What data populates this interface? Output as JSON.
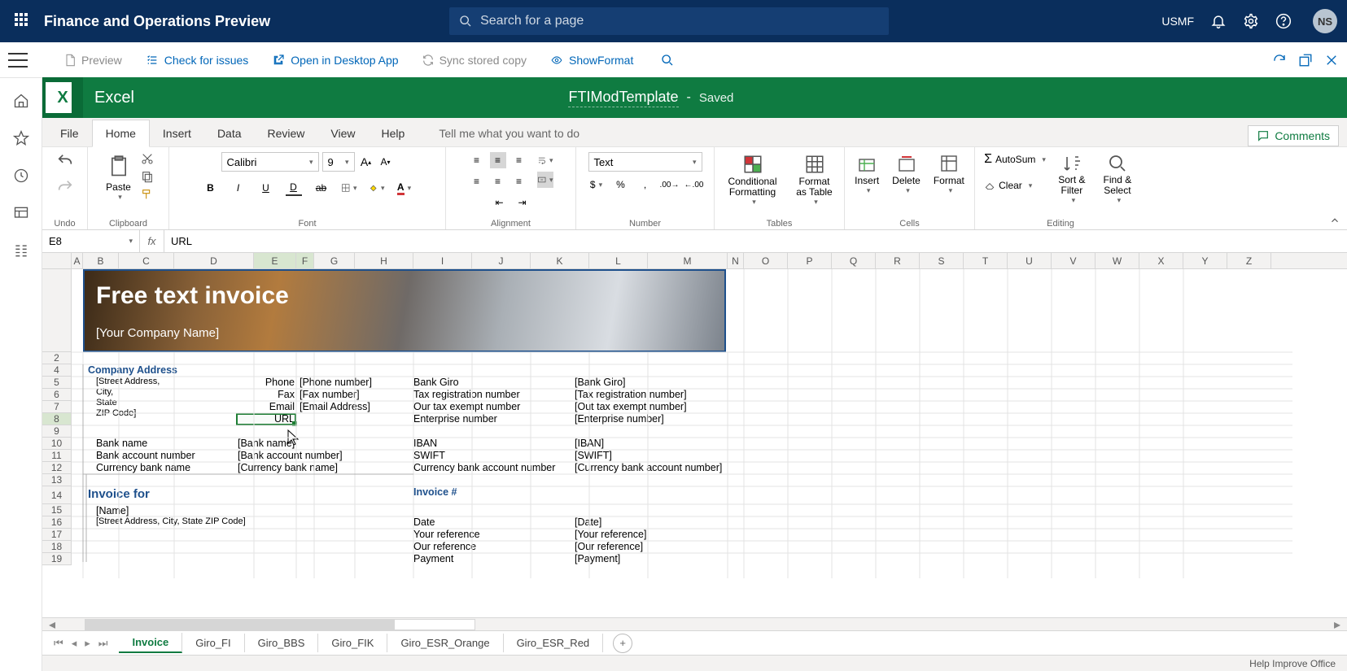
{
  "d365": {
    "title": "Finance and Operations Preview",
    "search_placeholder": "Search for a page",
    "company": "USMF",
    "user_initials": "NS"
  },
  "toolbar": {
    "preview": "Preview",
    "check": "Check for issues",
    "open_desktop": "Open in Desktop App",
    "sync": "Sync stored copy",
    "show_format": "ShowFormat"
  },
  "excel": {
    "app_name": "Excel",
    "file_name": "FTIModTemplate",
    "save_status": "Saved",
    "tabs": [
      "File",
      "Home",
      "Insert",
      "Data",
      "Review",
      "View",
      "Help"
    ],
    "tell_me": "Tell me what you want to do",
    "comments": "Comments",
    "ribbon": {
      "undo": "Undo",
      "clipboard": "Clipboard",
      "paste": "Paste",
      "font_group": "Font",
      "font_name": "Calibri",
      "font_size": "9",
      "alignment": "Alignment",
      "number_group": "Number",
      "number_format": "Text",
      "tables_group": "Tables",
      "cond_fmt": "Conditional Formatting",
      "fmt_table": "Format as Table",
      "cells_group": "Cells",
      "insert": "Insert",
      "delete": "Delete",
      "format": "Format",
      "editing_group": "Editing",
      "autosum": "AutoSum",
      "clear": "Clear",
      "sortfilter": "Sort & Filter",
      "findselect": "Find & Select"
    },
    "namebox": "E8",
    "formula": "URL",
    "sheet": {
      "banner_title": "Free text invoice",
      "company_name": "[Your Company Name]",
      "section_company_address": "Company Address",
      "address_lines": "[Street Address,\nCity,\nState\nZIP Code]",
      "phone_lbl": "Phone",
      "phone_val": "[Phone number]",
      "fax_lbl": "Fax",
      "fax_val": "[Fax number]",
      "email_lbl": "Email",
      "email_val": "[Email Address]",
      "url_lbl": "URL",
      "bankgiro_lbl": "Bank Giro",
      "bankgiro_val": "[Bank Giro]",
      "taxreg_lbl": "Tax registration number",
      "taxreg_val": "[Tax registration number]",
      "taxexempt_lbl": "Our tax exempt number",
      "taxexempt_val": "[Out tax exempt number]",
      "entnum_lbl": "Enterprise number",
      "entnum_val": "[Enterprise number]",
      "bankname_lbl": "Bank name",
      "bankname_val": "[Bank name]",
      "bankacct_lbl": "Bank account number",
      "bankacct_val": "[Bank account number]",
      "currbank_lbl": "Currency bank name",
      "currbank_val": "[Currency bank name]",
      "iban_lbl": "IBAN",
      "iban_val": "[IBAN]",
      "swift_lbl": "SWIFT",
      "swift_val": "[SWIFT]",
      "currbankacct_lbl": "Currency bank account number",
      "currbankacct_val": "[Currency bank account number]",
      "invoice_for": "Invoice for",
      "name_val": "[Name]",
      "addr2_val": "[Street Address, City, State ZIP Code]",
      "invoice_num": "Invoice #",
      "date_lbl": "Date",
      "date_val": "[Date]",
      "yourref_lbl": "Your reference",
      "yourref_val": "[Your reference]",
      "ourref_lbl": "Our reference",
      "ourref_val": "[Our reference]",
      "payment_lbl": "Payment",
      "payment_val": "[Payment]"
    },
    "sheet_tabs": [
      "Invoice",
      "Giro_FI",
      "Giro_BBS",
      "Giro_FIK",
      "Giro_ESR_Orange",
      "Giro_ESR_Red"
    ],
    "status_right": "Help Improve Office"
  }
}
